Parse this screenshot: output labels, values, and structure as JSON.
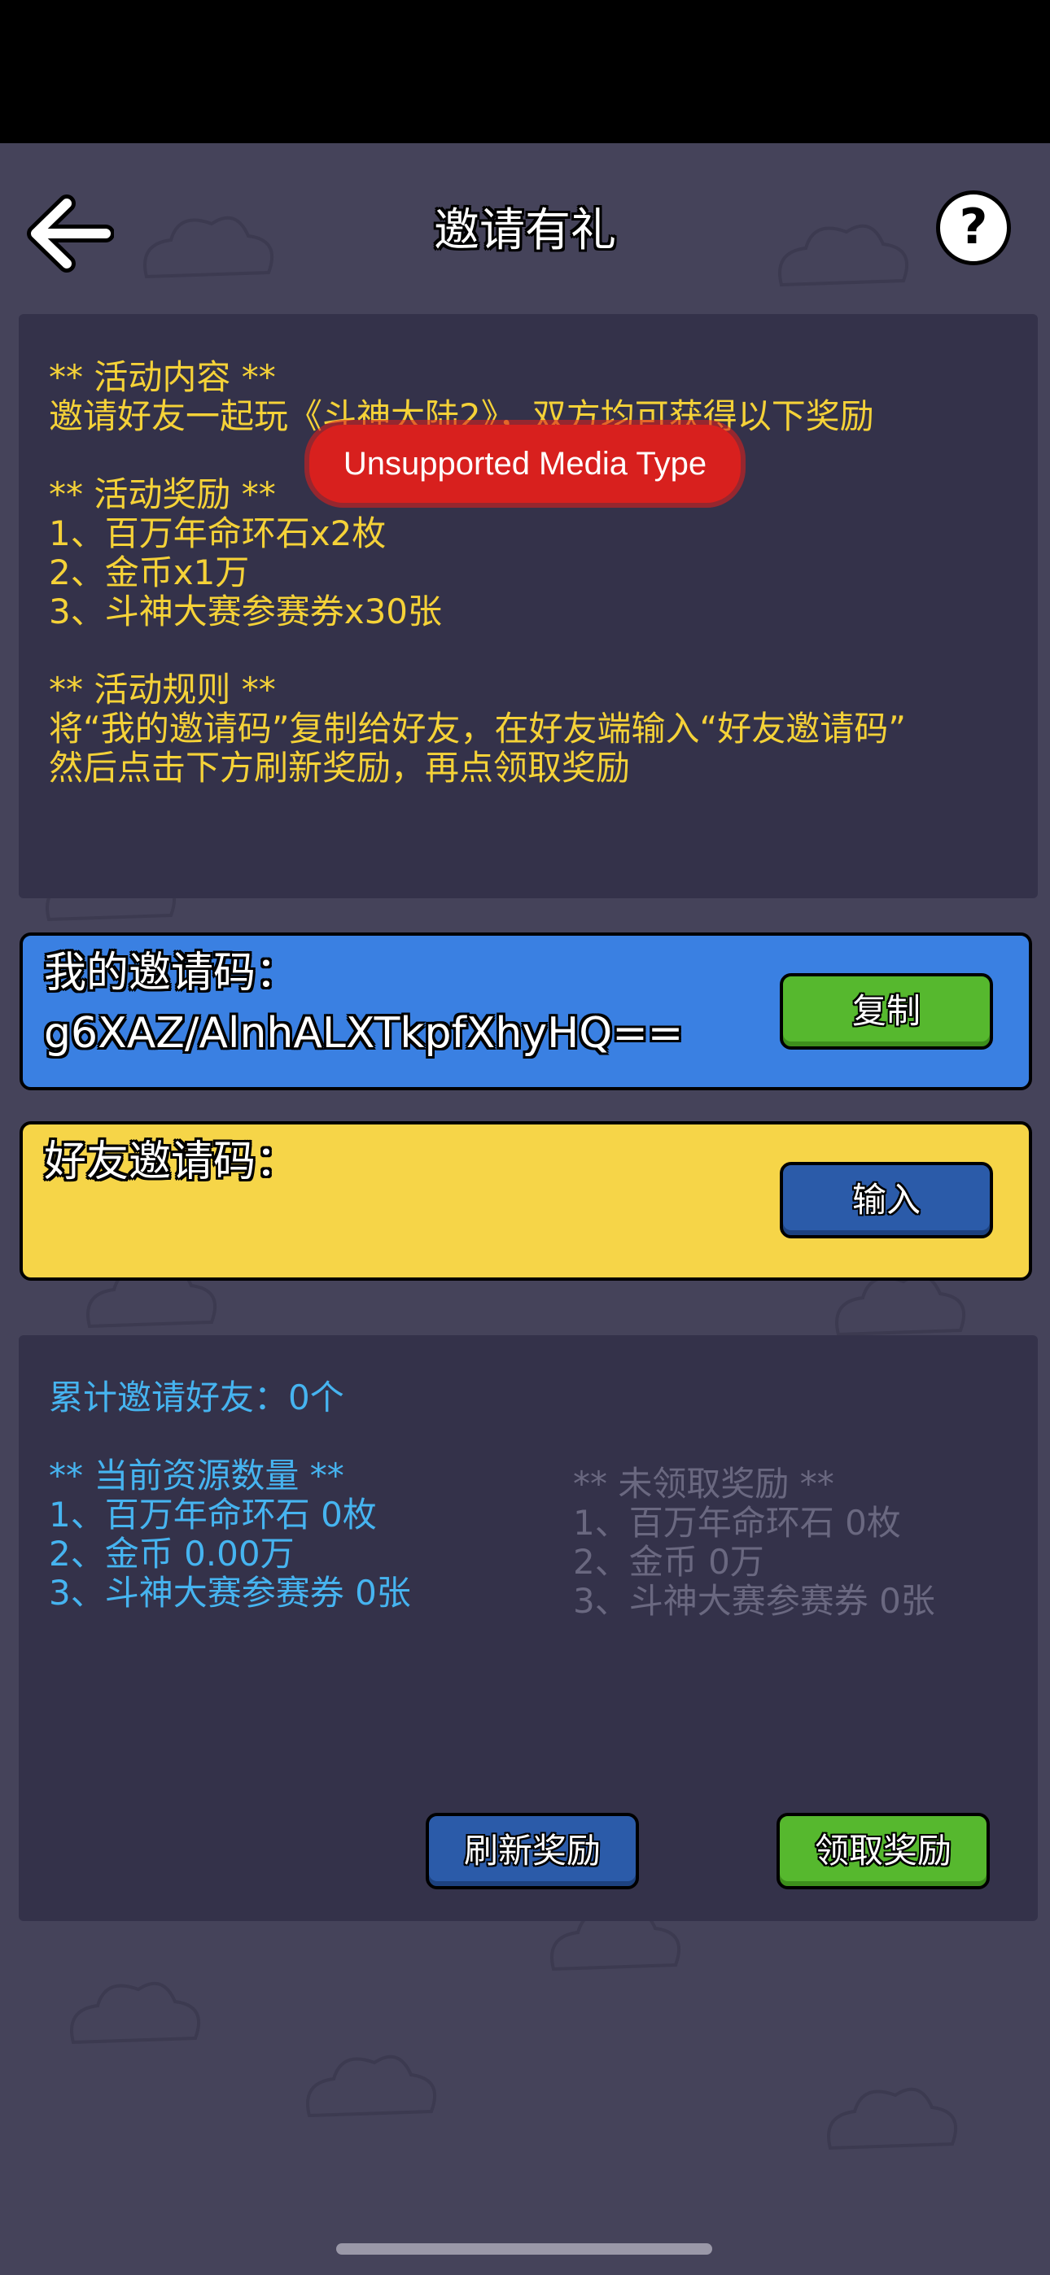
{
  "header": {
    "title": "邀请有礼",
    "back_icon": "arrow-left-icon",
    "help_label": "?"
  },
  "info": {
    "section1_title": "** 活动内容 **",
    "section1_line1": "邀请好友一起玩《斗神大陆2》，双方均可获得以下奖励",
    "section2_title": "** 活动奖励 **",
    "reward1": "1、百万年命环石x2枚",
    "reward2": "2、金币x1万",
    "reward3": "3、斗神大赛参赛券x30张",
    "section3_title": "** 活动规则 **",
    "rule1": "将“我的邀请码”复制给好友，在好友端输入“好友邀请码”",
    "rule2": "然后点击下方刷新奖励，再点领取奖励"
  },
  "overlay_error": "Unsupported Media Type",
  "my_code": {
    "label": "我的邀请码：",
    "value": "g6XAZ/AlnhALXTkpfXhyHQ==",
    "copy_button": "复制"
  },
  "friend_code": {
    "label": "好友邀请码：",
    "input_button": "输入"
  },
  "stats": {
    "invited": "累计邀请好友：0个",
    "current_title": "** 当前资源数量 **",
    "current1": "1、百万年命环石 0枚",
    "current2": "2、金币 0.00万",
    "current3": "3、斗神大赛参赛券 0张",
    "pending_title": "** 未领取奖励 **",
    "pending1": "1、百万年命环石 0枚",
    "pending2": "2、金币 0万",
    "pending3": "3、斗神大赛参赛券 0张",
    "refresh_button": "刷新奖励",
    "claim_button": "领取奖励"
  },
  "colors": {
    "background": "#45435a",
    "panel": "#34324a",
    "yellow_text": "#f5d238",
    "cyan_text": "#46b4f0",
    "grey_text": "#6a6880",
    "blue_box": "#3a80e2",
    "yellow_box": "#f6d548",
    "green_button": "#56b82e",
    "blue_button": "#2b5ba9"
  }
}
